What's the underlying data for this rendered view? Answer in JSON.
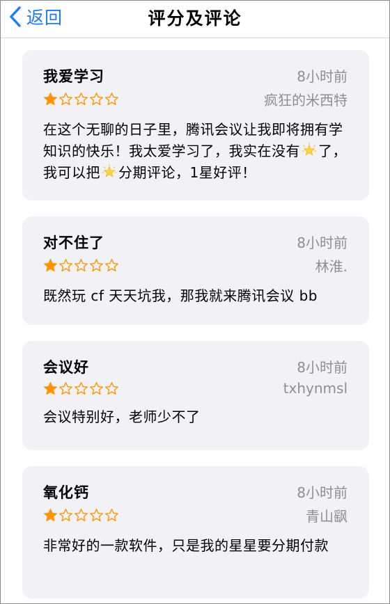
{
  "nav": {
    "back_label": "返回",
    "title": "评分及评论"
  },
  "colors": {
    "accent": "#1a7cf5",
    "star": "#ff9500",
    "card_bg": "#f1f1f6",
    "muted": "#8e8e93"
  },
  "reviews": [
    {
      "title": "我爱学习",
      "time": "8小时前",
      "rating": 1,
      "max_rating": 5,
      "author": "疯狂的米西特",
      "body_part1": "在这个无聊的日子里，腾讯会议让我即将拥有学知识的快乐！我太爱学习了，我实在没有",
      "emoji": "glowing-star-icon",
      "body_part2": "了，我可以把",
      "body_part3": "分期评论，1星好评！"
    },
    {
      "title": "对不住了",
      "time": "8小时前",
      "rating": 1,
      "max_rating": 5,
      "author": "林淮.",
      "body": "既然玩 cf 天天坑我，那我就来腾讯会议 bb"
    },
    {
      "title": "会议好",
      "time": "8小时前",
      "rating": 1,
      "max_rating": 5,
      "author": "txhynmsl",
      "body": "会议特别好，老师少不了"
    },
    {
      "title": "氧化钙",
      "time": "8小时前",
      "rating": 1,
      "max_rating": 5,
      "author": "青山飖",
      "body": "非常好的一款软件，只是我的星星要分期付款"
    }
  ]
}
